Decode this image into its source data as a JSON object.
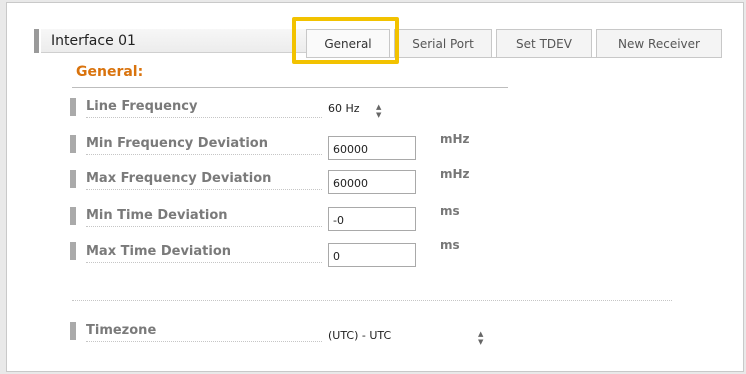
{
  "interface": {
    "title": "Interface 01"
  },
  "tabs": [
    {
      "label": "General",
      "active": true
    },
    {
      "label": "Serial Port",
      "active": false
    },
    {
      "label": "Set TDEV",
      "active": false
    },
    {
      "label": "New Receiver",
      "active": false
    }
  ],
  "section": {
    "title": "General:"
  },
  "fields": {
    "line_frequency": {
      "label": "Line Frequency",
      "value": "60 Hz"
    },
    "min_freq_dev": {
      "label": "Min Frequency Deviation",
      "value": "60000",
      "unit": "mHz"
    },
    "max_freq_dev": {
      "label": "Max Frequency Deviation",
      "value": "60000",
      "unit": "mHz"
    },
    "min_time_dev": {
      "label": "Min Time Deviation",
      "value": "-0",
      "unit": "ms"
    },
    "max_time_dev": {
      "label": "Max Time Deviation",
      "value": "0",
      "unit": "ms"
    },
    "timezone": {
      "label": "Timezone",
      "value": "(UTC) - UTC"
    }
  },
  "colors": {
    "section_title": "#d9730d",
    "highlight": "#f2c200"
  },
  "icons": {
    "spinner": "up-down-arrows-icon"
  }
}
